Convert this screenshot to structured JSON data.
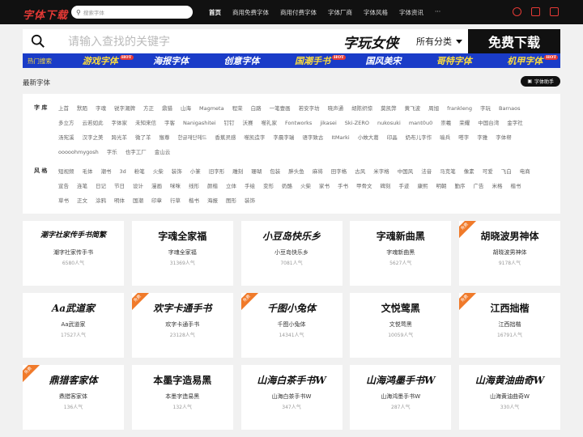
{
  "topbar": {
    "logo": "字体下载",
    "search_placeholder": "搜索字体",
    "nav": [
      "首页",
      "商用免费字体",
      "商用付费字体",
      "字体厂商",
      "字体风格",
      "字体资讯",
      "···"
    ]
  },
  "banner": {
    "search_placeholder": "请输入查找的关键字",
    "brand": "字玩女侠",
    "category": "所有分类",
    "download": "免费下载"
  },
  "hotbar": {
    "label": "热门搜索",
    "items": [
      {
        "text": "游戏字体",
        "badge": "HOT"
      },
      {
        "text": "海报字体",
        "badge": ""
      },
      {
        "text": "创意字体",
        "badge": ""
      },
      {
        "text": "国潮手书",
        "badge": "HOT"
      },
      {
        "text": "国风美宋",
        "badge": ""
      },
      {
        "text": "哥特字体",
        "badge": ""
      },
      {
        "text": "机甲字体",
        "badge": "HOT"
      }
    ]
  },
  "section": {
    "title": "最新字体",
    "helper": "字体助手"
  },
  "filters": {
    "library_label": "字 库",
    "library": [
      "上首",
      "默陌",
      "字魂",
      "锐字潮牌",
      "方正",
      "鼎猎",
      "山海",
      "Magmeta",
      "程荣",
      "白路",
      "一笔壹画",
      "若安字坊",
      "晓声通",
      "胡陈织惊",
      "莫凯弊",
      "黄飞波",
      "周旭",
      "frankleng",
      "字玩",
      "Barnaos",
      "多立方",
      "云若如此",
      "字体家",
      "未知来信",
      "字客",
      "Nanigashitei",
      "钉钉",
      "沃赛",
      "噬礼家",
      "Fontworks",
      "jikasei",
      "Ski-ZERO",
      "nukosuki",
      "mant0u0",
      "崇羲",
      "荣耀",
      "中国台湾",
      "金字社",
      "汤宪溪",
      "汉字之美",
      "跨光羊",
      "微了羊",
      "猴尊",
      "한글재단헤드",
      "香蕉灵感",
      "噬凯造字",
      "字晨字瑞",
      "语字致古",
      "ItMarki",
      "小故大葛",
      "印晶",
      "奶布儿字作",
      "喻兵",
      "嗒字",
      "字雅",
      "字体帮",
      "ooooohmygosh",
      "字乐",
      "也字工厂",
      "金山云"
    ],
    "style_label": "风 格",
    "style": [
      "短视频",
      "毛体",
      "潮书",
      "3d",
      "粉笔",
      "火柴",
      "装饰",
      "小篆",
      "旧字形",
      "雕刻",
      "珊瑚",
      "包装",
      "胖头鱼",
      "麻将",
      "田字格",
      "古风",
      "米字格",
      "中国风",
      "法音",
      "马克笔",
      "像素",
      "可爱",
      "飞白",
      "电商",
      "宣告",
      "连笔",
      "日记",
      "节日",
      "设计",
      "漫画",
      "咪咪",
      "线形",
      "颜楷",
      "立体",
      "手绘",
      "变形",
      "奶酪",
      "火柴",
      "家书",
      "手书",
      "甲骨文",
      "碑刻",
      "手迹",
      "康熙",
      "明朝",
      "勤序",
      "广告",
      "米格",
      "楷书",
      "草书",
      "正文",
      "涂鸦",
      "明体",
      "国潮",
      "印章",
      "行草",
      "楷书",
      "海报",
      "图形",
      "装饰"
    ]
  },
  "cards": [
    {
      "preview": "潮字社家传手书简繁",
      "name": "潮字社家传手书",
      "pop": "6580人气",
      "badge": ""
    },
    {
      "preview": "字魂全家福",
      "name": "字魂全家福",
      "pop": "31369人气",
      "badge": ""
    },
    {
      "preview": "小豆岛快乐乡",
      "name": "小豆岛快乐乡",
      "pop": "7081人气",
      "badge": ""
    },
    {
      "preview": "字魂新曲黑",
      "name": "字魂新曲黑",
      "pop": "5627人气",
      "badge": ""
    },
    {
      "preview": "胡晓波男神体",
      "name": "胡晓波男神体",
      "pop": "9178人气",
      "badge": "免费"
    },
    {
      "preview": "Aa武道家",
      "name": "Aa武道家",
      "pop": "17527人气",
      "badge": ""
    },
    {
      "preview": "欢字卡通手书",
      "name": "欢字卡通手书",
      "pop": "23128人气",
      "badge": "免费"
    },
    {
      "preview": "千图小兔体",
      "name": "千图小兔体",
      "pop": "14341人气",
      "badge": "免费"
    },
    {
      "preview": "文悦莺黑",
      "name": "文悦莺黑",
      "pop": "10059人气",
      "badge": ""
    },
    {
      "preview": "江西拙楷",
      "name": "江西拙楷",
      "pop": "16791人气",
      "badge": "免费"
    },
    {
      "preview": "鼎猎客家体",
      "name": "鼎猎客家体",
      "pop": "136人气",
      "badge": "免费"
    },
    {
      "preview": "本墨字造易黑",
      "name": "本墨字造易黑",
      "pop": "132人气",
      "badge": ""
    },
    {
      "preview": "山海白茶手书W",
      "name": "山海白茶手书W",
      "pop": "347人气",
      "badge": ""
    },
    {
      "preview": "山海鸿墨手书W",
      "name": "山海鸿墨手书W",
      "pop": "287人气",
      "badge": ""
    },
    {
      "preview": "山海黄油曲奇W",
      "name": "山海黄油曲奇W",
      "pop": "330人气",
      "badge": ""
    }
  ]
}
